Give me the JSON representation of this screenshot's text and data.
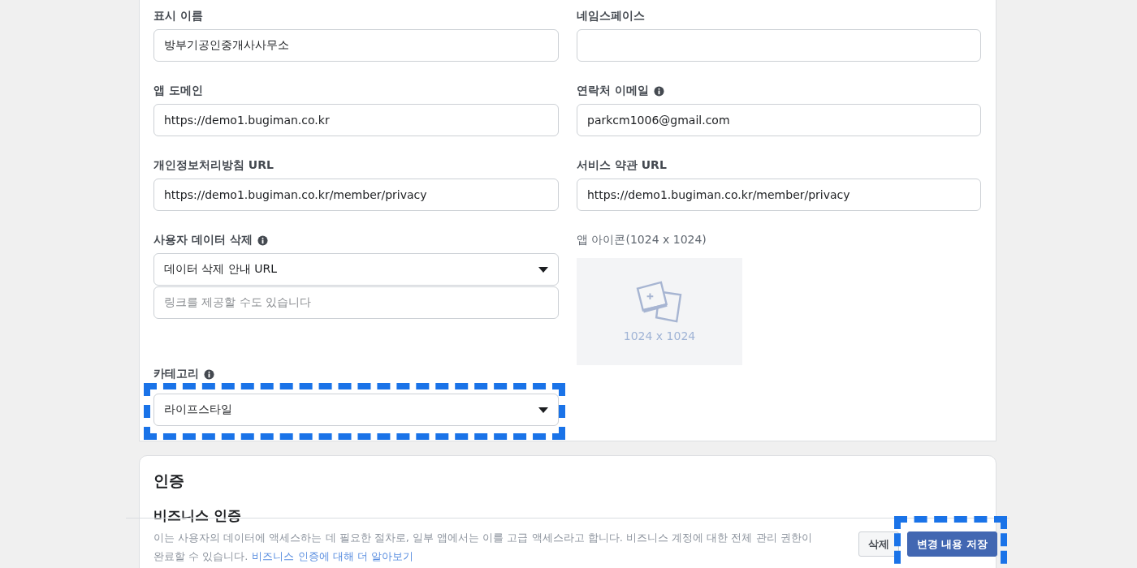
{
  "settings_card": {
    "left_fields": [
      {
        "kind": "text",
        "label": "표시 이름",
        "info": false,
        "value": "방부기공인중개사사무소",
        "highlighted": false
      },
      {
        "kind": "text",
        "label": "앱 도메인",
        "info": false,
        "value": "https://demo1.bugiman.co.kr",
        "highlighted": false
      },
      {
        "kind": "text",
        "label": "개인정보처리방침 URL",
        "info": false,
        "value": "https://demo1.bugiman.co.kr/member/privacy",
        "highlighted": false
      },
      {
        "kind": "select_input",
        "label": "사용자 데이터 삭제",
        "info": true,
        "value": "데이터 삭제 안내 URL",
        "placeholder": "링크를 제공할 수도 있습니다",
        "highlighted": false
      },
      {
        "kind": "select",
        "label": "카테고리",
        "info": true,
        "value": "라이프스타일",
        "highlighted": true
      }
    ],
    "right_fields": [
      {
        "kind": "text",
        "label": "네임스페이스",
        "info": false,
        "highlighted": false
      },
      {
        "kind": "text",
        "label": "연락처 이메일",
        "info": true,
        "value": "parkcm1006@gmail.com",
        "highlighted": false
      },
      {
        "kind": "text",
        "label": "서비스 약관 URL",
        "info": false,
        "value": "https://demo1.bugiman.co.kr/member/privacy",
        "highlighted": false
      },
      {
        "kind": "image",
        "label": "앱 아이콘(1024 x 1024)",
        "info": false,
        "caption": "1024 x 1024",
        "highlighted": false
      }
    ]
  },
  "verification_card": {
    "title": "인증",
    "subtitle": "비즈니스 인증",
    "text_line_1": "이는 사용자의 데이터에 액세스하는 데 필요한 절차로, 일부 앱에서는 이를 고급 액세스라고 합니다. 비즈니스 계정에 대한 전체 관리 권한이",
    "text_line_2": "완료할 수 있습니다.",
    "link": "비즈니스 인증에 대해 더 알아보기"
  },
  "footer_bar": {
    "buttons": [
      {
        "kind": "secondary",
        "label": "삭제",
        "highlighted": false
      },
      {
        "kind": "primary",
        "label": "변경 내용 저장",
        "highlighted": true
      }
    ]
  }
}
